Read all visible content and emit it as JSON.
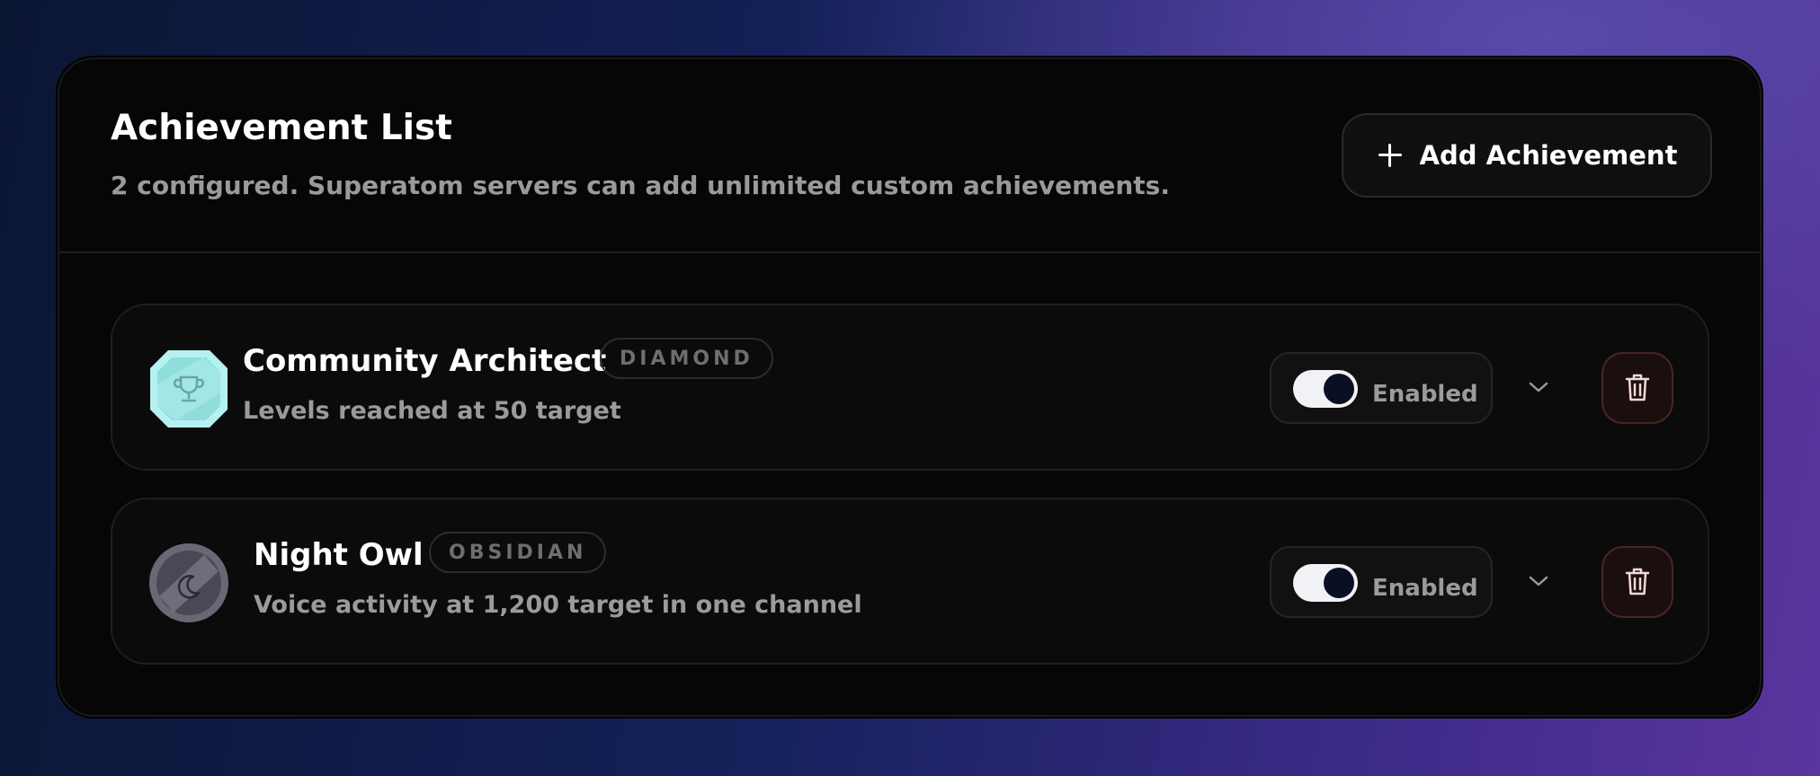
{
  "header": {
    "title": "Achievement List",
    "subtitle": "2 configured. Superatom servers can add unlimited custom achievements.",
    "add_button_label": "Add Achievement",
    "add_button_icon": "plus-icon"
  },
  "achievements": [
    {
      "name": "Community Architect",
      "tier": "DIAMOND",
      "description": "Levels reached at 50 target",
      "badge_icon": "trophy-icon",
      "badge_color": "#a8ecec",
      "status_label": "Enabled",
      "enabled": true
    },
    {
      "name": "Night Owl",
      "tier": "OBSIDIAN",
      "description": "Voice activity at 1,200 target in one channel",
      "badge_icon": "moon-icon",
      "badge_color": "#5a5866",
      "status_label": "Enabled",
      "enabled": true
    }
  ],
  "colors": {
    "panel_bg": "#060606",
    "card_bg": "#0b0b0b",
    "delete_accent": "#4a2522",
    "text_muted": "#9b9b9b"
  }
}
